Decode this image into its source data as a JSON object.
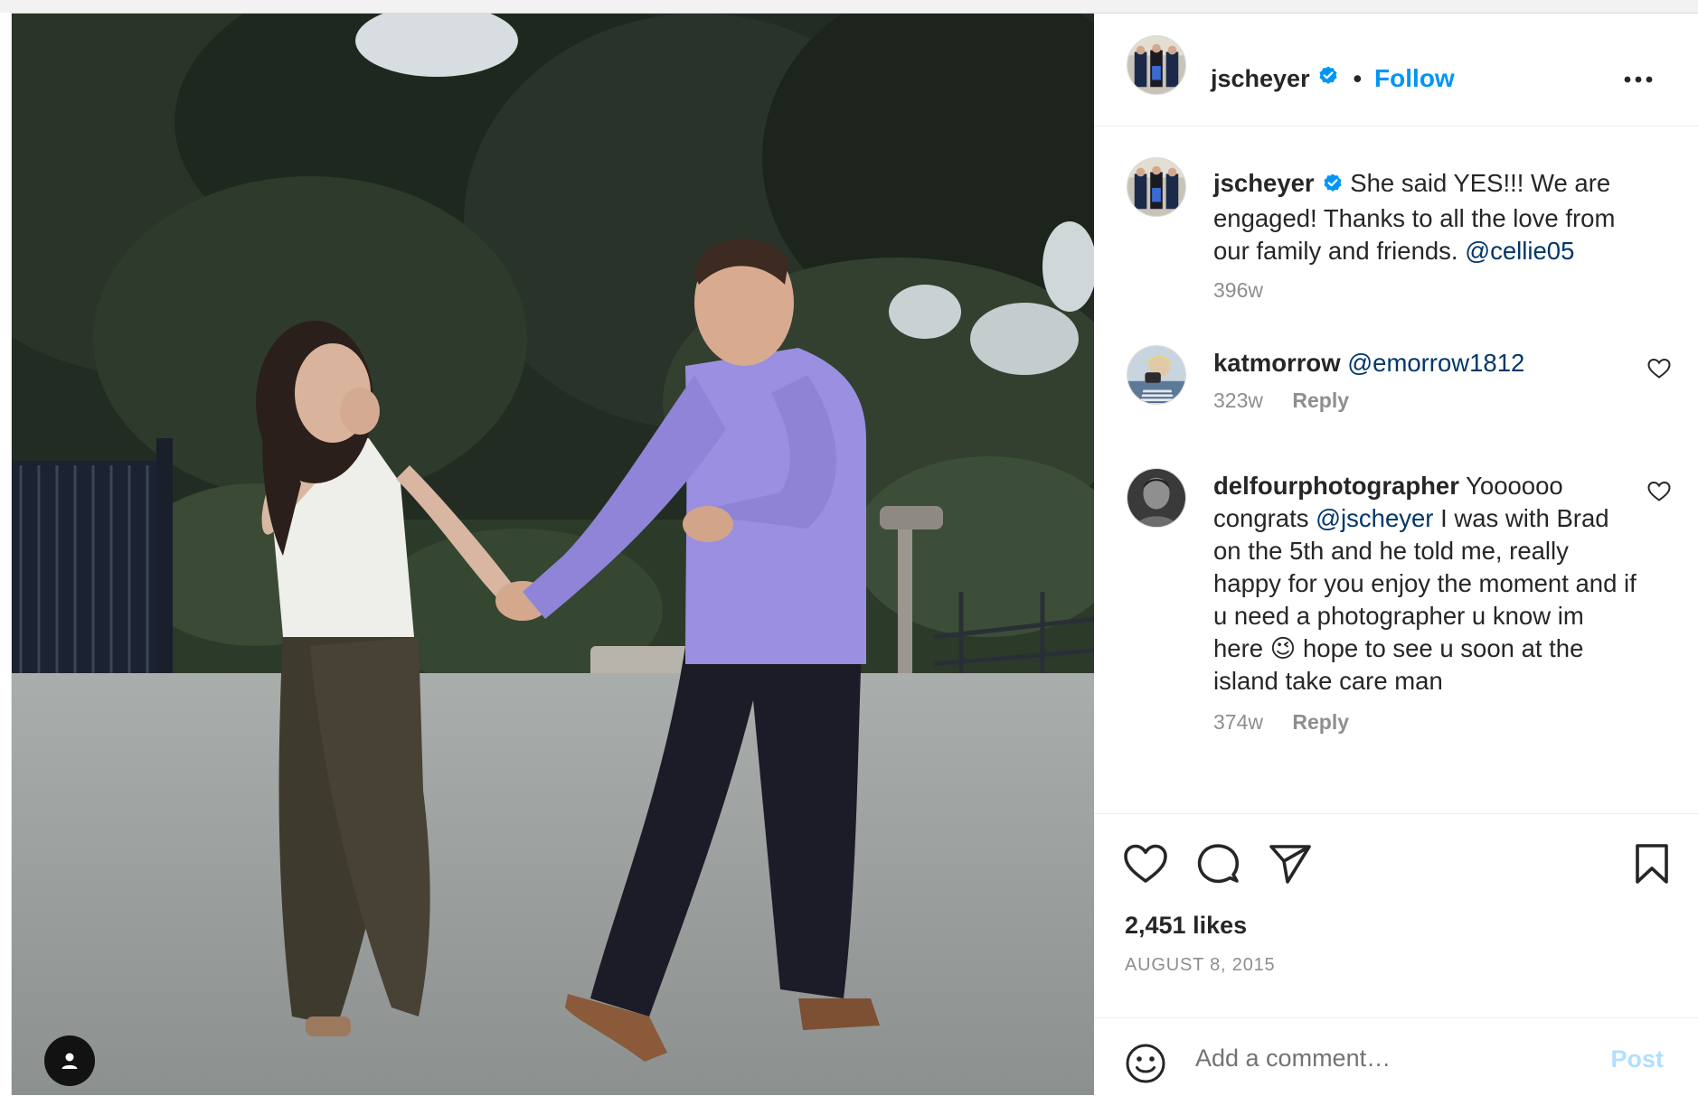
{
  "post": {
    "author": "jscheyer",
    "author_verified": true,
    "follow_label": "Follow",
    "dot": "•"
  },
  "caption": {
    "username": "jscheyer",
    "text": "She said YES!!! We are engaged! Thanks to all the love from our family and friends.",
    "mention": "@cellie05",
    "time": "396w"
  },
  "comments": [
    {
      "username": "katmorrow",
      "mention": "@emorrow1812",
      "text": "",
      "time": "323w",
      "reply_label": "Reply"
    },
    {
      "username": "delfourphotographer",
      "text_before": "Yoooooo congrats",
      "mention": "@jscheyer",
      "text_after": "I was with Brad on the 5th and he told me, really happy for you enjoy the moment and if u need a photographer u know im here 😉 hope to see u soon at the island take care man",
      "time": "374w",
      "reply_label": "Reply"
    }
  ],
  "engagement": {
    "likes": "2,451 likes",
    "date": "AUGUST 8, 2015"
  },
  "composer": {
    "placeholder": "Add a comment…",
    "post_label": "Post"
  },
  "icons": {
    "like": "heart-icon",
    "comment": "comment-bubble-icon",
    "share": "paper-plane-icon",
    "save": "bookmark-icon",
    "more": "more-horizontal-icon",
    "emoji": "emoji-icon",
    "user_tag": "user-tag-icon",
    "verified": "verified-badge-icon"
  },
  "colors": {
    "link_blue": "#0095f6",
    "mention_blue": "#00376b",
    "muted": "#8e8e8e",
    "verified_blue": "#0095f6",
    "post_disabled": "#b2dffc"
  }
}
